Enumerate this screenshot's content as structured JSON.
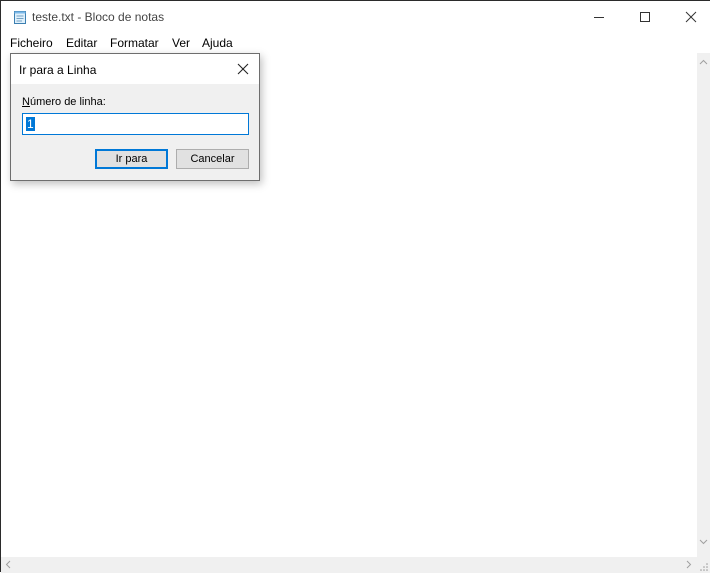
{
  "window": {
    "title": "teste.txt - Bloco de notas",
    "icons": [
      "notepad-icon",
      "minimize-icon",
      "maximize-icon",
      "close-icon"
    ]
  },
  "menu": {
    "items": [
      "Ficheiro",
      "Editar",
      "Formatar",
      "Ver",
      "Ajuda"
    ]
  },
  "dialog": {
    "title": "Ir para a Linha",
    "label_underline": "N",
    "label_rest": "úmero de linha:",
    "input_value": "1",
    "ok_label": "Ir para",
    "cancel_label": "Cancelar",
    "accent": "#0078d7"
  }
}
